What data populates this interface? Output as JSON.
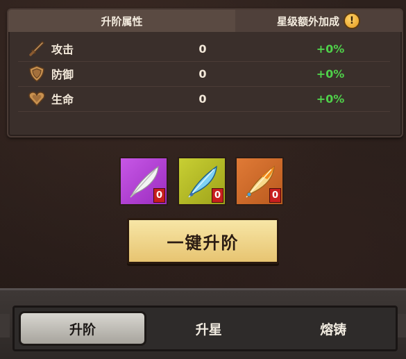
{
  "panel": {
    "header_left": "升阶属性",
    "header_right": "星级额外加成",
    "header_icon": "exclamation-icon",
    "header_icon_glyph": "!",
    "rows": [
      {
        "label": "攻击",
        "value": "0",
        "bonus": "+0%",
        "icon": "sword-icon"
      },
      {
        "label": "防御",
        "value": "0",
        "bonus": "+0%",
        "icon": "shield-icon"
      },
      {
        "label": "生命",
        "value": "0",
        "bonus": "+0%",
        "icon": "heart-icon"
      }
    ]
  },
  "materials": [
    {
      "name": "white-feather",
      "count": "0",
      "color": "#b43fd6"
    },
    {
      "name": "blue-feather",
      "count": "0",
      "color": "#b9bf26"
    },
    {
      "name": "golden-feather",
      "count": "0",
      "color": "#d66a2a"
    }
  ],
  "upgrade_button": {
    "label": "一键升阶"
  },
  "tabs": [
    {
      "label": "升阶",
      "active": true
    },
    {
      "label": "升星",
      "active": false
    },
    {
      "label": "熔铸",
      "active": false
    }
  ]
}
